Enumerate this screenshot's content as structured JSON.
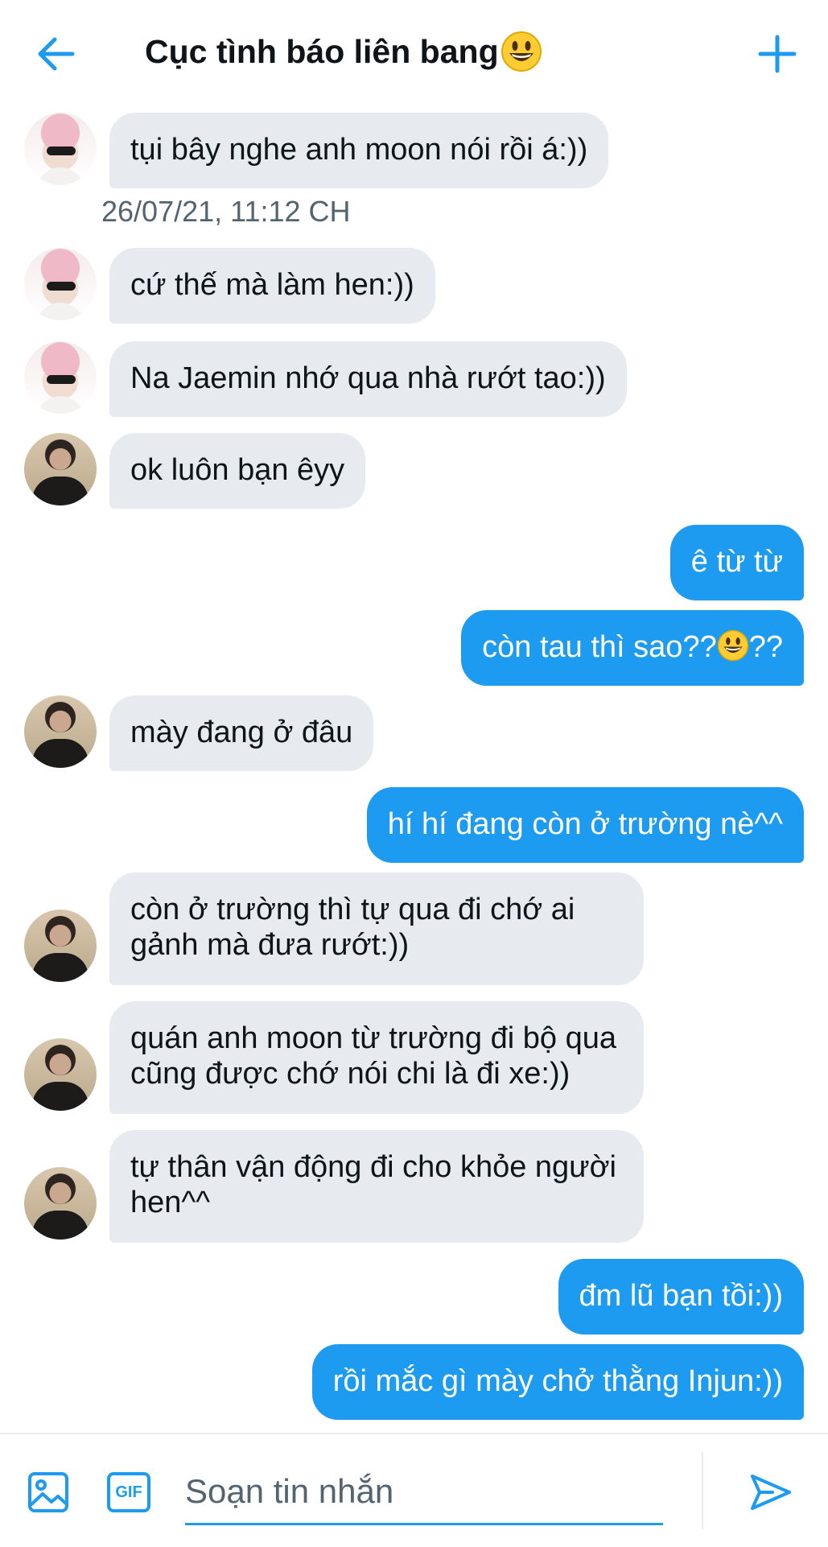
{
  "header": {
    "title": "Cục tình báo liên bang",
    "back_icon": "arrow-left-icon",
    "new_icon": "plus-icon",
    "accent_color": "#1d9bf0"
  },
  "messages": [
    {
      "direction": "in",
      "sender_avatar": "pink-hair-avatar",
      "text": "tụi bây nghe anh moon nói rồi á:))"
    },
    {
      "timestamp": "26/07/21, 11:12 CH"
    },
    {
      "direction": "in",
      "sender_avatar": "pink-hair-avatar",
      "text": "cứ thế mà làm hen:))"
    },
    {
      "direction": "in",
      "sender_avatar": "pink-hair-avatar",
      "text": "Na Jaemin nhớ qua nhà rướt tao:))"
    },
    {
      "direction": "in",
      "sender_avatar": "dark-hair-avatar",
      "text": "ok luôn bạn êyy"
    },
    {
      "direction": "out",
      "text": "ê từ từ"
    },
    {
      "direction": "out",
      "text_before": "còn tau thì sao??",
      "emoji": "grinning-face",
      "text_after": "??"
    },
    {
      "direction": "in",
      "sender_avatar": "dark-hair-avatar",
      "text": "mày đang ở đâu"
    },
    {
      "direction": "out",
      "text": "hí hí đang còn ở trường nè^^"
    },
    {
      "direction": "in",
      "sender_avatar": "dark-hair-avatar",
      "text_line1": "còn ở trường thì tự qua đi chớ ai",
      "text_line2": "gảnh mà đưa rướt:))"
    },
    {
      "direction": "in",
      "sender_avatar": "dark-hair-avatar",
      "text_line1": "quán anh moon từ trường đi bộ qua",
      "text_line2": "cũng được chớ nói chi là đi xe:))"
    },
    {
      "direction": "in",
      "sender_avatar": "dark-hair-avatar",
      "text_line1": "tự thân vận động đi cho khỏe người",
      "text_line2": "hen^^"
    },
    {
      "direction": "out",
      "text": "đm lũ bạn tồi:))"
    },
    {
      "direction": "out",
      "text": "rồi mắc gì mày chở thằng Injun:))"
    }
  ],
  "composer": {
    "placeholder": "Soạn tin nhắn",
    "value": "",
    "media_icon": "image-icon",
    "gif_label": "GIF",
    "send_icon": "send-icon"
  },
  "colors": {
    "incoming_bubble": "#e7ebef",
    "outgoing_bubble": "#1d9bf0",
    "timestamp_text": "#536471"
  }
}
